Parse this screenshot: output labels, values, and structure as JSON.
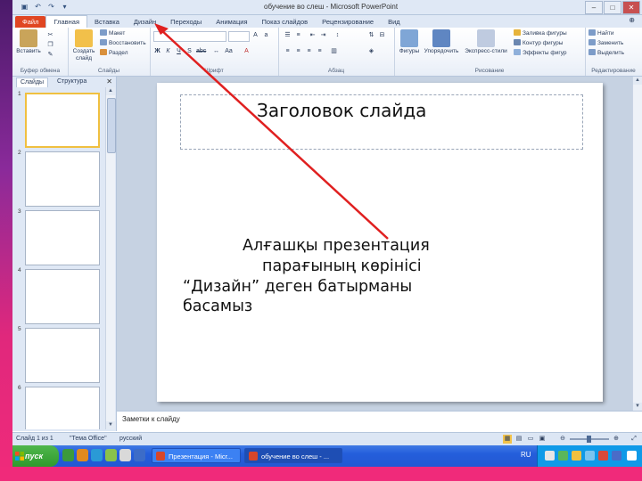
{
  "app": {
    "window_title": "обучение во слеш - Microsoft PowerPoint",
    "quick_access": [
      "save",
      "undo",
      "redo",
      "customize"
    ]
  },
  "ribbon_tabs": [
    "Файл",
    "Главная",
    "Вставка",
    "Дизайн",
    "Переходы",
    "Анимация",
    "Показ слайдов",
    "Рецензирование",
    "Вид"
  ],
  "ribbon_groups": {
    "clipboard": {
      "label": "Буфер обмена",
      "paste": "Вставить"
    },
    "slides": {
      "label": "Слайды",
      "new_slide": "Создать слайд",
      "layout": "Макет",
      "reset": "Восстановить",
      "section": "Раздел"
    },
    "font": {
      "label": "Шрифт"
    },
    "paragraph": {
      "label": "Абзац"
    },
    "drawing": {
      "label": "Рисование",
      "shapes": "Фигуры",
      "arrange": "Упорядочить",
      "quick_styles": "Экспресс-стили",
      "fill": "Заливка фигуры",
      "outline": "Контур фигуры",
      "effects": "Эффекты фигур"
    },
    "editing": {
      "label": "Редактирование",
      "find": "Найти",
      "replace": "Заменить",
      "select": "Выделить"
    }
  },
  "left_panel": {
    "tabs": [
      "Слайды",
      "Структура"
    ],
    "close": "✕",
    "slide_numbers": [
      "1",
      "2",
      "3",
      "4",
      "5",
      "6"
    ]
  },
  "slide": {
    "title": "Заголовок слайда",
    "instruction_lines": [
      "Алғашқы презентация",
      "парағының  көрінісі",
      "“Дизайн” деген батырманы",
      "басамыз"
    ]
  },
  "notes": {
    "text": "Заметки к слайду"
  },
  "status_bar": {
    "slide_info": "Слайд 1 из 1",
    "theme": "\"Тема Office\"",
    "language": "русский"
  },
  "taskbar": {
    "start": "пуск",
    "buttons": [
      "Презентация - Micr...",
      "обучение во слеш - ..."
    ],
    "language": "RU"
  },
  "annotation": {
    "color": "#e02020"
  },
  "colors": {
    "file_tab": "#e04622",
    "accent_magenta": "#f02a7a"
  }
}
